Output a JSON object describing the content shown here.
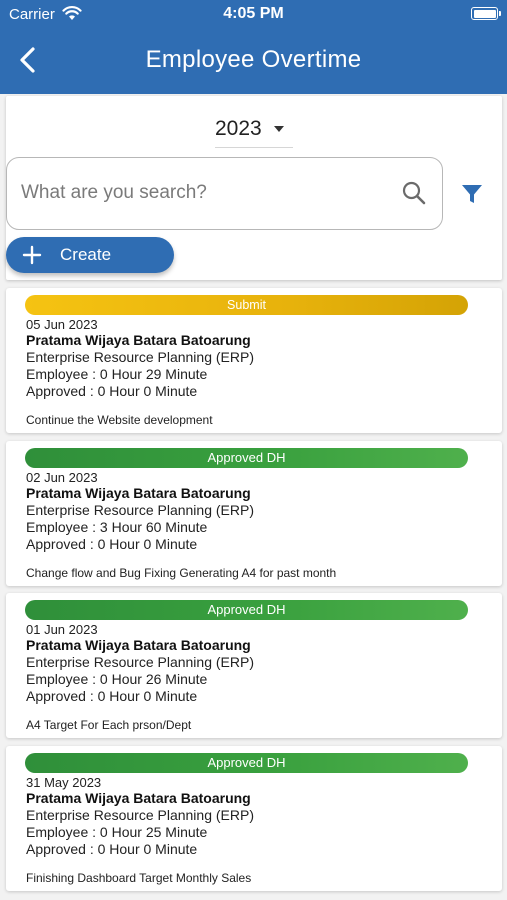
{
  "status_bar": {
    "carrier": "Carrier",
    "time": "4:05 PM"
  },
  "header": {
    "title": "Employee Overtime"
  },
  "filter": {
    "year": "2023",
    "search_placeholder": "What are you search?",
    "create_label": "Create"
  },
  "colors": {
    "primary": "#2f6db3",
    "submit_badge": "#f0bf12",
    "approved_badge": "#39a03e"
  },
  "items": [
    {
      "status": "Submit",
      "date": "05 Jun 2023",
      "name": "Pratama Wijaya Batara Batoarung",
      "department": "Enterprise Resource Planning (ERP)",
      "employee": "Employee : 0 Hour 29 Minute",
      "approved": "Approved : 0 Hour 0 Minute",
      "description": "Continue the Website development"
    },
    {
      "status": "Approved DH",
      "date": "02 Jun 2023",
      "name": "Pratama Wijaya Batara Batoarung",
      "department": "Enterprise Resource Planning (ERP)",
      "employee": "Employee : 3 Hour 60 Minute",
      "approved": "Approved : 0 Hour 0 Minute",
      "description": "Change flow and Bug Fixing Generating A4 for past month"
    },
    {
      "status": "Approved DH",
      "date": "01 Jun 2023",
      "name": "Pratama Wijaya Batara Batoarung",
      "department": "Enterprise Resource Planning (ERP)",
      "employee": "Employee : 0 Hour 26 Minute",
      "approved": "Approved : 0 Hour 0 Minute",
      "description": "A4 Target For Each prson/Dept"
    },
    {
      "status": "Approved DH",
      "date": "31 May 2023",
      "name": "Pratama Wijaya Batara Batoarung",
      "department": "Enterprise Resource Planning (ERP)",
      "employee": "Employee : 0 Hour 25 Minute",
      "approved": "Approved : 0 Hour 0 Minute",
      "description": "Finishing Dashboard Target Monthly Sales"
    }
  ]
}
